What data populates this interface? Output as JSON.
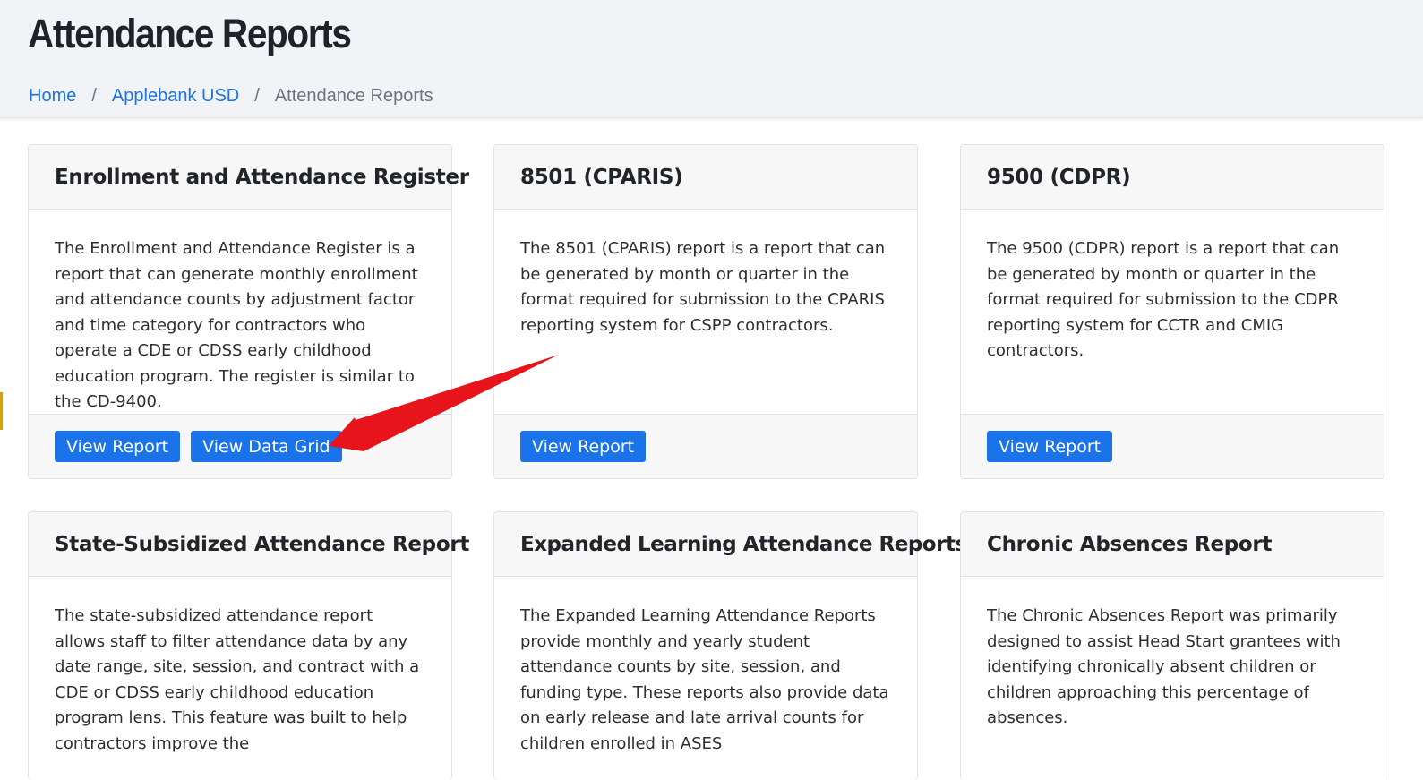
{
  "header": {
    "title": "Attendance Reports",
    "breadcrumb": [
      {
        "label": "Home"
      },
      {
        "label": "Applebank USD"
      },
      {
        "label": "Attendance Reports"
      }
    ],
    "separator": "/"
  },
  "cards": [
    {
      "title": "Enrollment and Attendance Register",
      "description": "The Enrollment and Attendance Register is a report that can generate monthly enrollment and attendance counts by adjustment factor and time category for contractors who operate a CDE or CDSS early childhood education program. The register is similar to the CD-9400.",
      "buttons": [
        "View Report",
        "View Data Grid"
      ]
    },
    {
      "title": "8501 (CPARIS)",
      "description": "The 8501 (CPARIS) report is a report that can be generated by month or quarter in the format required for submission to the CPARIS reporting system for CSPP contractors.",
      "buttons": [
        "View Report"
      ]
    },
    {
      "title": "9500 (CDPR)",
      "description": "The 9500 (CDPR) report is a report that can be generated by month or quarter in the format required for submission to the CDPR reporting system for CCTR and CMIG contractors.",
      "buttons": [
        "View Report"
      ]
    },
    {
      "title": "State-Subsidized Attendance Report",
      "description": "The state-subsidized attendance report allows staff to filter attendance data by any date range, site, session, and contract with a CDE or CDSS early childhood education program lens. This feature was built to help contractors improve the"
    },
    {
      "title": "Expanded Learning Attendance Reports",
      "description": "The Expanded Learning Attendance Reports provide monthly and yearly student attendance counts by site, session, and funding type. These reports also provide data on early release and late arrival counts for children enrolled in ASES"
    },
    {
      "title": "Chronic Absences Report",
      "description": "The Chronic Absences Report was primarily designed to assist Head Start grantees with identifying chronically absent children or children approaching this percentage of absences."
    }
  ],
  "colors": {
    "primary": "#1a73e8",
    "annotation_arrow": "#e8141b",
    "header_bg": "#f1f3f6"
  }
}
